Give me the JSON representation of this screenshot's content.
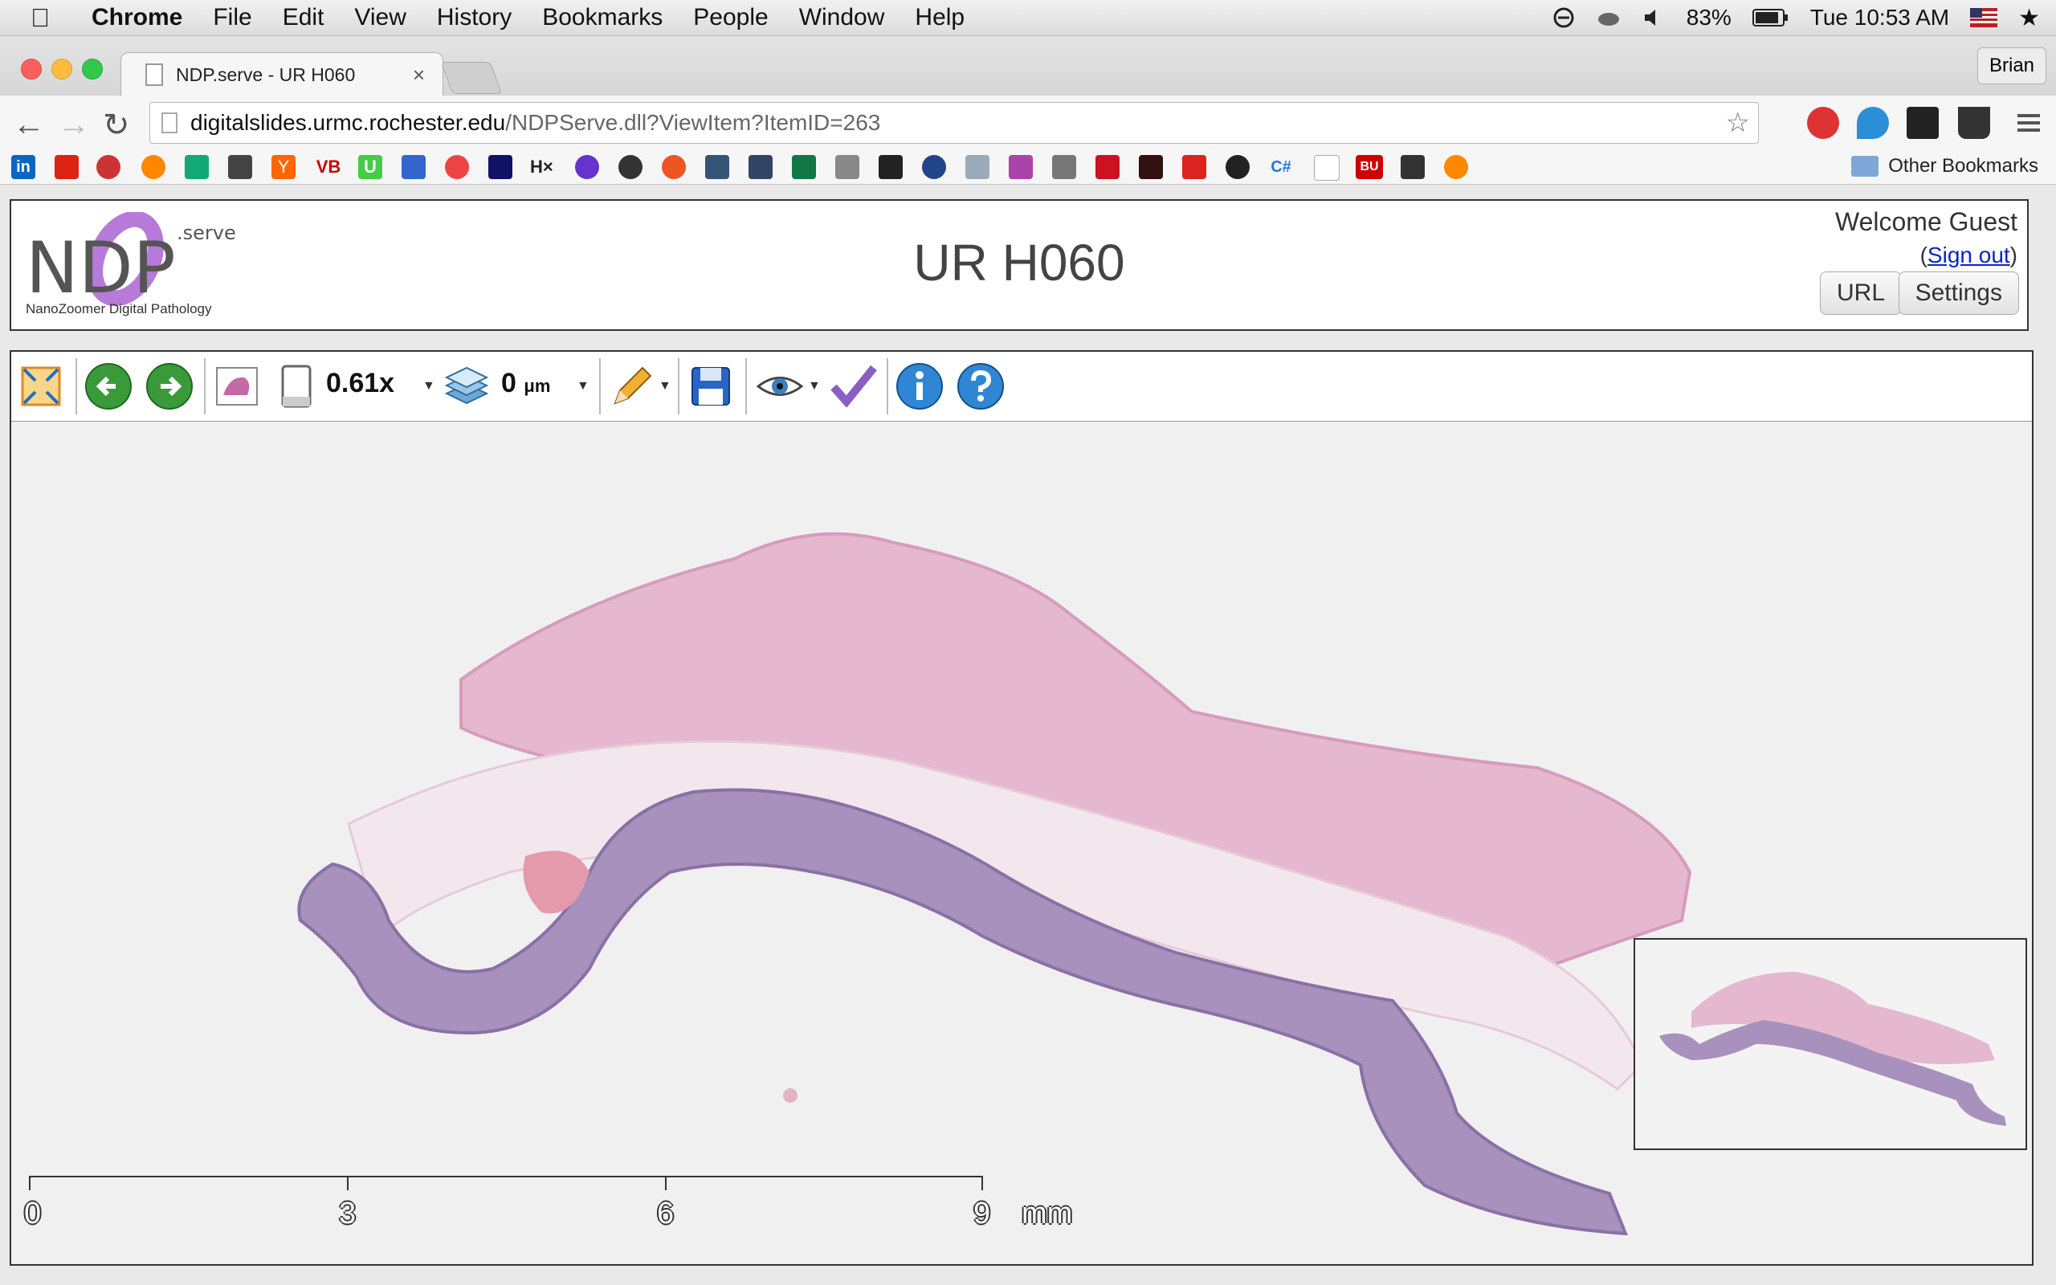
{
  "menubar": {
    "app": "Chrome",
    "items": [
      "File",
      "Edit",
      "View",
      "History",
      "Bookmarks",
      "People",
      "Window",
      "Help"
    ],
    "battery": "83%",
    "clock": "Tue 10:53 AM"
  },
  "tab": {
    "title": "NDP.serve - UR H060",
    "close": "×"
  },
  "profile": "Brian",
  "omnibox": {
    "host": "digitalslides.urmc.rochester.edu",
    "path": "/NDPServe.dll?ViewItem?ItemID=263"
  },
  "bookmarks": {
    "other": "Other Bookmarks",
    "labels": [
      "in",
      "H×",
      "C#",
      "BU",
      "VB",
      "U",
      "Y"
    ]
  },
  "header": {
    "title": "UR H060",
    "welcome": "Welcome Guest",
    "signout_open": "(",
    "signout": "Sign out",
    "signout_close": ")",
    "url_btn": "URL",
    "settings_btn": "Settings",
    "logo_serve": ".serve",
    "logo_letters": "NDP",
    "logo_tagline": "NanoZoomer Digital Pathology"
  },
  "viewer": {
    "zoom": "0.61x",
    "focus_value": "0",
    "focus_unit": "μm",
    "scale": {
      "labels": [
        "0",
        "3",
        "6",
        "9"
      ],
      "unit": "mm"
    }
  },
  "colors": {
    "tissue_pink": "#e6b6d0",
    "tissue_purple": "#9c86b2",
    "background": "#f1f0f1"
  }
}
